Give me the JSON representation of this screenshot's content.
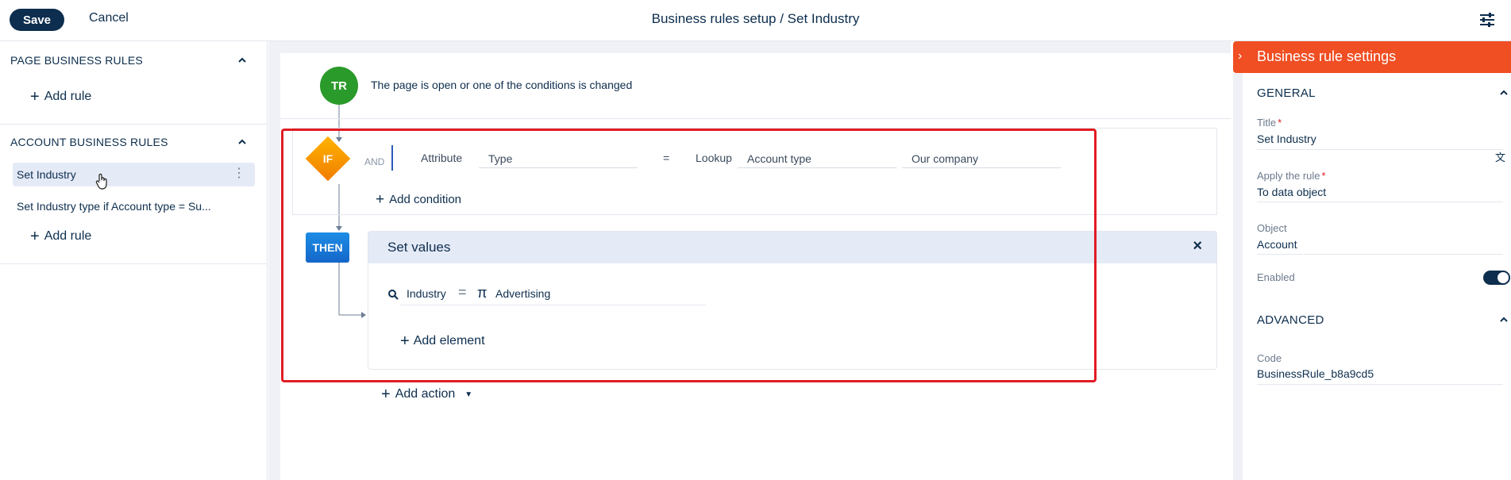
{
  "toolbar": {
    "save_label": "Save",
    "cancel_label": "Cancel",
    "title": "Business rules setup / Set Industry"
  },
  "left_panel": {
    "page_section": {
      "title": "PAGE BUSINESS RULES",
      "add_label": "Add rule"
    },
    "account_section": {
      "title": "ACCOUNT BUSINESS RULES",
      "items": [
        {
          "label": "Set Industry"
        },
        {
          "label": "Set Industry type if Account type = Su..."
        }
      ],
      "add_label": "Add rule"
    }
  },
  "canvas": {
    "trigger": {
      "badge": "TR",
      "text": "The page is open or one of the conditions is changed"
    },
    "if_block": {
      "badge": "IF",
      "logic": "AND",
      "condition": {
        "left_type": "Attribute",
        "left_value": "Type",
        "operator": "=",
        "right_type": "Lookup",
        "right_object": "Account type",
        "right_value": "Our company"
      },
      "add_condition_label": "Add condition"
    },
    "then_block": {
      "badge": "THEN",
      "action_title": "Set values",
      "assignment": {
        "attribute": "Industry",
        "operator": "=",
        "value": "Advertising"
      },
      "add_element_label": "Add element"
    },
    "add_action_label": "Add action"
  },
  "settings": {
    "title": "Business rule settings",
    "general_label": "GENERAL",
    "fields": {
      "title_label": "Title",
      "title_value": "Set Industry",
      "apply_label": "Apply the rule",
      "apply_value": "To data object",
      "object_label": "Object",
      "object_value": "Account",
      "enabled_label": "Enabled",
      "enabled": true
    },
    "advanced_label": "ADVANCED",
    "code_label": "Code",
    "code_value": "BusinessRule_b8a9cd5"
  },
  "colors": {
    "primary": "#0d2e4e",
    "accent": "#f04e23",
    "highlight": "#e01c24",
    "trigger": "#2a9a2a",
    "if": "#f59a00",
    "then": "#1467c8"
  }
}
